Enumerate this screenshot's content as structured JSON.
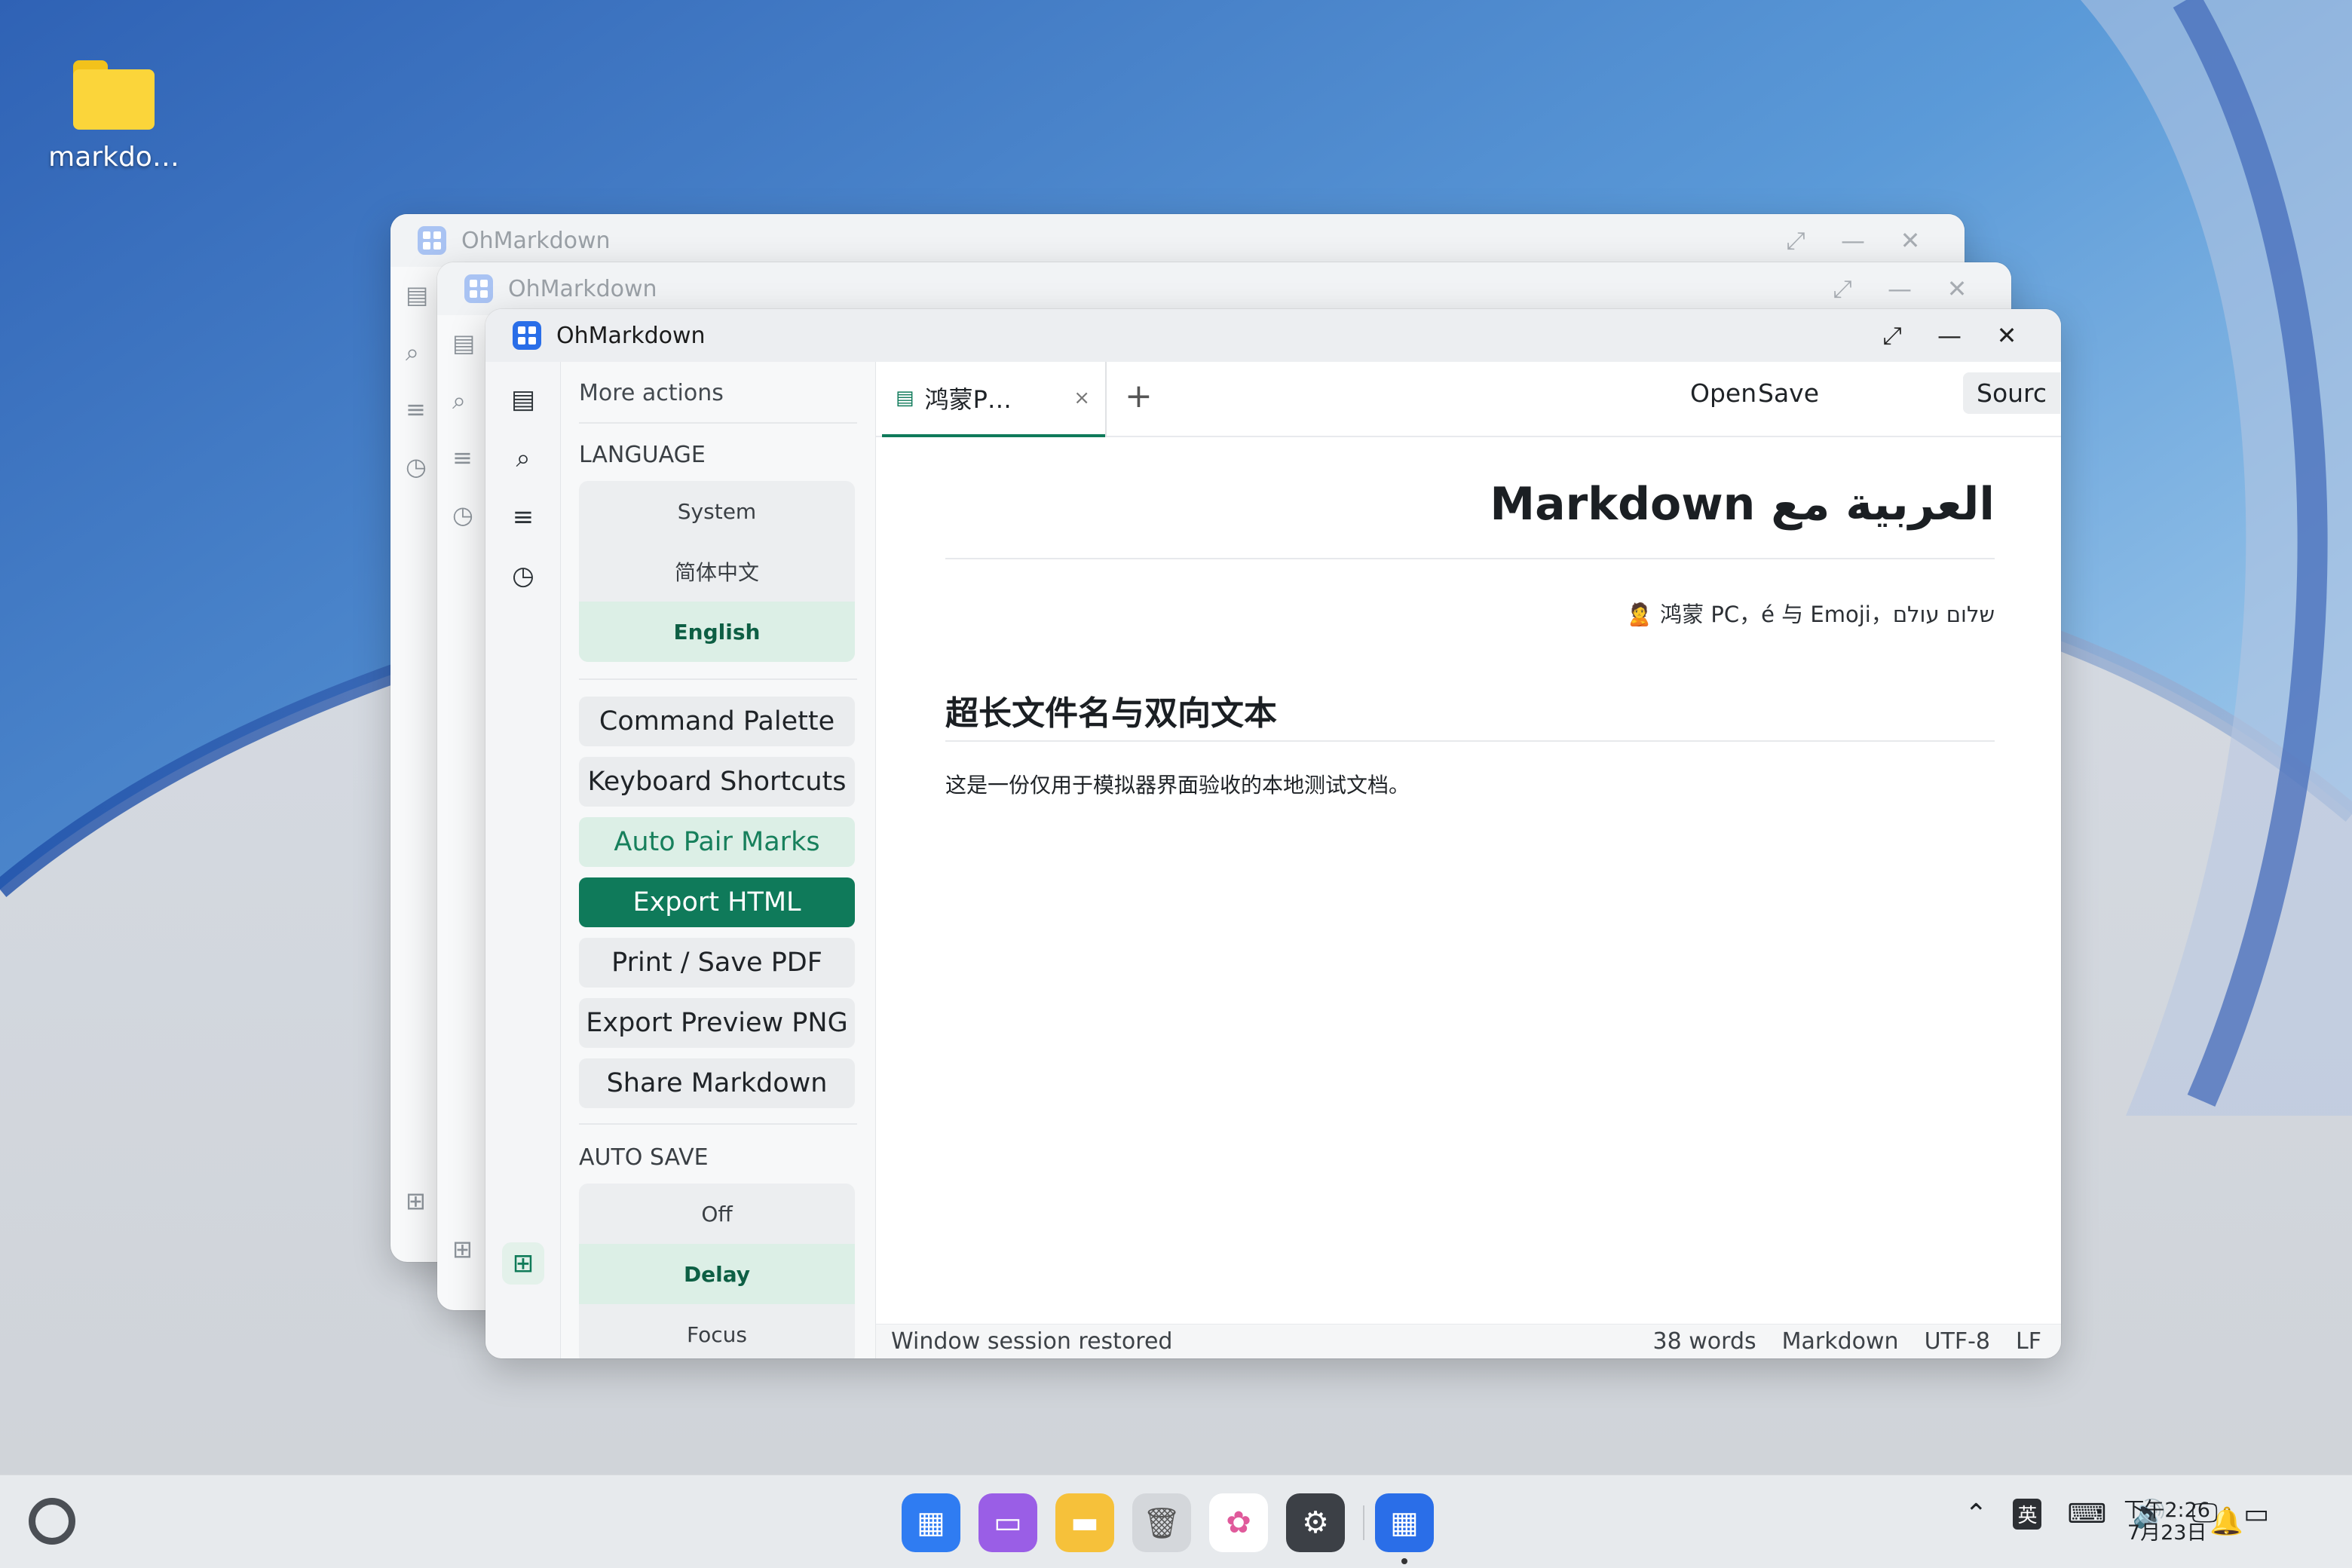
{
  "desktop": {
    "folder_label": "markdo…",
    "folder_icon": "folder-icon"
  },
  "windows": {
    "background_title_1": "OhMarkdown",
    "background_title_2": "OhMarkdown",
    "main_title": "OhMarkdown",
    "controls": {
      "maximize": "⤢",
      "minimize": "—",
      "close": "✕"
    }
  },
  "sidebar": {
    "more_actions": "More actions",
    "language_heading": "LANGUAGE",
    "language_options": [
      "System",
      "简体中文",
      "English"
    ],
    "language_selected": "English",
    "actions": [
      "Command Palette",
      "Keyboard Shortcuts",
      "Auto Pair Marks",
      "Export HTML",
      "Print / Save PDF",
      "Export Preview PNG",
      "Share Markdown"
    ],
    "autosave_heading": "AUTO SAVE",
    "autosave_options": [
      "Off",
      "Delay",
      "Focus"
    ],
    "autosave_selected": "Delay"
  },
  "tabs": {
    "active_name": "鸿蒙P…",
    "close": "×",
    "new": "+"
  },
  "toolbar": {
    "open": "Open",
    "save": "Save",
    "source": "Sourc"
  },
  "document": {
    "title": "العربية مع Markdown",
    "meta": "🙎 鸿蒙 PC，é 与 Emoji，שלום עולם",
    "heading": "超长文件名与双向文本",
    "paragraph": "这是一份仅用于模拟器界面验收的本地测试文档。"
  },
  "status_bar": {
    "message": "Window session restored",
    "words": "38 words",
    "mode": "Markdown",
    "encoding": "UTF-8",
    "line_ending": "LF"
  },
  "taskbar": {
    "ime": "英",
    "time": "下午2:26",
    "date": "7月23日"
  },
  "colors": {
    "accent": "#0f7a5a",
    "accent_soft": "#dcefe6",
    "app_blue": "#2a6ee8"
  }
}
